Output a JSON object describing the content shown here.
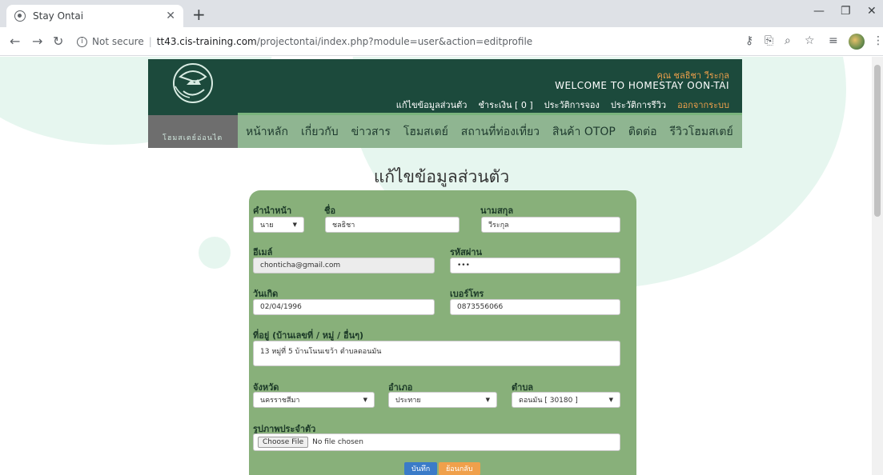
{
  "browser": {
    "tab_title": "Stay Ontai",
    "url_security": "Not secure",
    "url_host": "tt43.cis-training.com",
    "url_path": "/projectontai/index.php?module=user&action=editprofile"
  },
  "header": {
    "logo_text": "โฮมสเตย์อ่อนไต",
    "user_greeting": "คุณ ชลธิชา วีระกุล",
    "welcome": "WELCOME TO HOMESTAY OON-TAI",
    "user_menu": {
      "edit_profile": "แก้ไขข้อมูลส่วนตัว",
      "payment": "ชำระเงิน [ 0 ]",
      "booking_history": "ประวัติการจอง",
      "review_history": "ประวัติการรีวิว",
      "logout": "ออกจากระบบ"
    },
    "main_menu": [
      "หน้าหลัก",
      "เกี่ยวกับ",
      "ข่าวสาร",
      "โฮมสเตย์",
      "สถานที่ท่องเที่ยว",
      "สินค้า OTOP",
      "ติดต่อ",
      "รีวิวโฮมสเตย์"
    ]
  },
  "page_title": "แก้ไขข้อมูลส่วนตัว",
  "form": {
    "prefix_label": "คำนำหน้า",
    "prefix_value": "นาย",
    "firstname_label": "ชื่อ",
    "firstname_value": "ชลธิชา",
    "lastname_label": "นามสกุล",
    "lastname_value": "วีระกุล",
    "email_label": "อีเมล์",
    "email_value": "chonticha@gmail.com",
    "password_label": "รหัสผ่าน",
    "password_value": "•••",
    "birthdate_label": "วันเกิด",
    "birthdate_value": "02/04/1996",
    "phone_label": "เบอร์โทร",
    "phone_value": "0873556066",
    "address_label": "ที่อยู่ (บ้านเลขที่ / หมู่ / อื่นๆ)",
    "address_value": "13 หมู่ที่ 5 บ้านโนนเขว้า ตำบลดอนมัน",
    "province_label": "จังหวัด",
    "province_value": "นครราชสีมา",
    "district_label": "อำเภอ",
    "district_value": "ประทาย",
    "subdistrict_label": "ตำบล",
    "subdistrict_value": "ดอนมัน [ 30180 ]",
    "photo_label": "รูปภาพประจำตัว",
    "file_button": "Choose File",
    "file_status": "No file chosen",
    "save_label": "บันทึก",
    "back_label": "ย้อนกลับ"
  },
  "colors": {
    "header_bg": "#1c4a3c",
    "menu_bg": "#8fb591",
    "card_bg": "#88b07a",
    "accent_orange": "#f0a04b",
    "save_btn": "#3a7bc8"
  }
}
